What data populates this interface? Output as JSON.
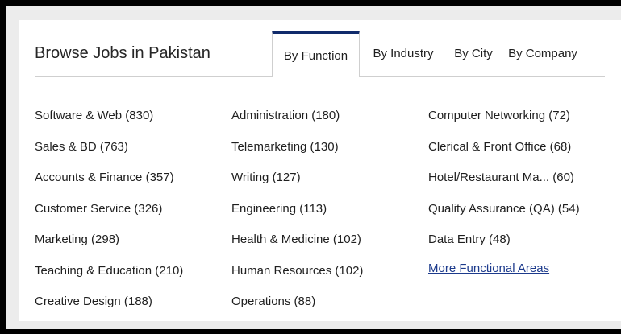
{
  "header": {
    "title": "Browse Jobs in Pakistan"
  },
  "tabs": [
    {
      "label": "By Function",
      "active": true
    },
    {
      "label": "By Industry",
      "active": false
    },
    {
      "label": "By City",
      "active": false
    },
    {
      "label": "By Company",
      "active": false
    }
  ],
  "columns": [
    {
      "items": [
        "Software & Web (830)",
        "Sales & BD (763)",
        "Accounts & Finance (357)",
        "Customer Service (326)",
        "Marketing (298)",
        "Teaching & Education (210)",
        "Creative Design (188)"
      ]
    },
    {
      "items": [
        "Administration (180)",
        "Telemarketing (130)",
        "Writing (127)",
        "Engineering (113)",
        "Health & Medicine (102)",
        "Human Resources (102)",
        "Operations (88)"
      ]
    },
    {
      "items": [
        "Computer Networking (72)",
        "Clerical & Front Office (68)",
        "Hotel/Restaurant Ma...  (60)",
        "Quality Assurance (QA) (54)",
        "Data Entry (48)"
      ],
      "more_link": "More Functional Areas"
    }
  ],
  "colors": {
    "active_tab_accent": "#102a6b",
    "link": "#1c3a8c",
    "text": "#1f1f1f"
  }
}
